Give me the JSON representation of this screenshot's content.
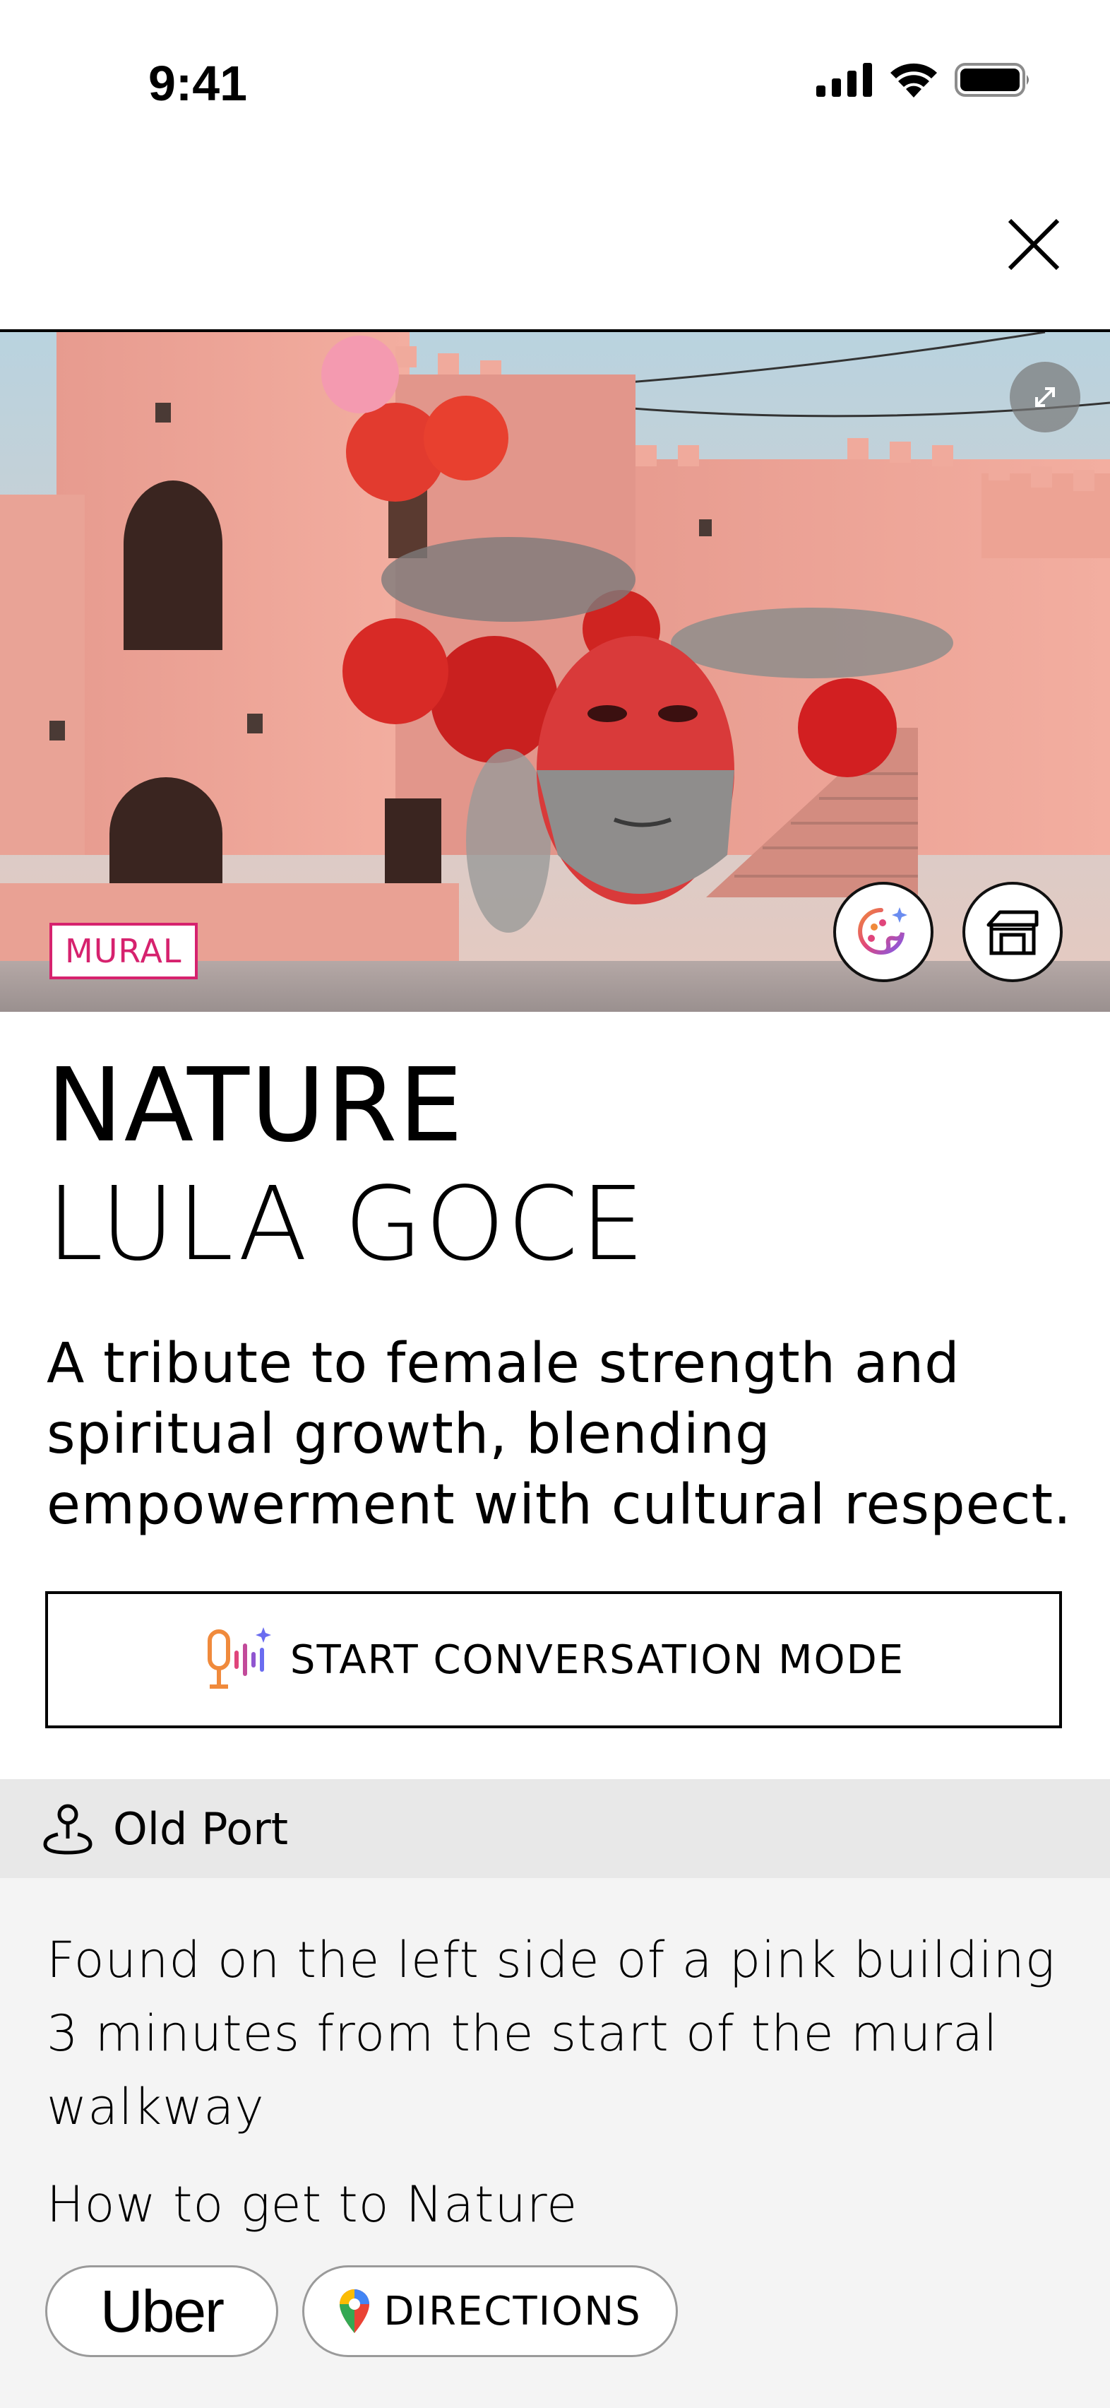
{
  "status_bar": {
    "time": "9:41"
  },
  "header": {
    "close_icon": "close-icon"
  },
  "hero": {
    "category": "MURAL",
    "expand_icon": "expand-icon",
    "buttons": [
      "palette-ai-icon",
      "building-icon"
    ]
  },
  "artwork": {
    "title": "NATURE",
    "artist": "LULA GOCE",
    "description": "A tribute to female strength and spiritual growth, blending empowerment with cultural respect."
  },
  "conversation": {
    "label": "START CONVERSATION MODE",
    "icon": "voice-ai-icon"
  },
  "location": {
    "name": "Old Port",
    "icon": "location-pin-icon"
  },
  "info": {
    "directions_text": "Found on the left side of a pink building 3 minutes from the start of the mural walkway",
    "how_to": "How to get to Nature"
  },
  "actions": {
    "uber_label": "Uber",
    "directions_label": "DIRECTIONS"
  },
  "colors": {
    "accent": "#d6226e",
    "divider": "#000000",
    "location_bg": "#e8e8e8",
    "info_bg": "#f4f4f4"
  }
}
